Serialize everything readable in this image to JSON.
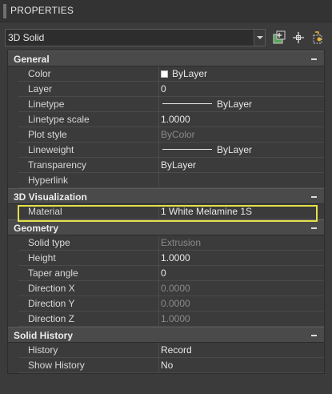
{
  "palette": {
    "title": "PROPERTIES"
  },
  "selector": {
    "value": "3D Solid"
  },
  "toolbar_icons": [
    "toggle-pickadd-icon",
    "select-objects-icon",
    "quick-select-icon"
  ],
  "sections": {
    "general": {
      "title": "General",
      "rows": [
        {
          "label": "Color",
          "value": "ByLayer"
        },
        {
          "label": "Layer",
          "value": "0"
        },
        {
          "label": "Linetype",
          "value": "ByLayer"
        },
        {
          "label": "Linetype scale",
          "value": "1.0000"
        },
        {
          "label": "Plot style",
          "value": "ByColor"
        },
        {
          "label": "Lineweight",
          "value": "ByLayer"
        },
        {
          "label": "Transparency",
          "value": "ByLayer"
        },
        {
          "label": "Hyperlink",
          "value": ""
        }
      ]
    },
    "visualization": {
      "title": "3D Visualization",
      "rows": [
        {
          "label": "Material",
          "value": "1 White Melamine 1S"
        }
      ]
    },
    "geometry": {
      "title": "Geometry",
      "rows": [
        {
          "label": "Solid type",
          "value": "Extrusion"
        },
        {
          "label": "Height",
          "value": "1.0000"
        },
        {
          "label": "Taper angle",
          "value": "0"
        },
        {
          "label": "Direction X",
          "value": "0.0000"
        },
        {
          "label": "Direction Y",
          "value": "0.0000"
        },
        {
          "label": "Direction Z",
          "value": "1.0000"
        }
      ]
    },
    "history": {
      "title": "Solid History",
      "rows": [
        {
          "label": "History",
          "value": "Record"
        },
        {
          "label": "Show History",
          "value": "No"
        }
      ]
    }
  },
  "colors": {
    "highlight": "#e5e04a",
    "swatch": "#ffffff",
    "background": "#3b3b3b",
    "section_header": "#4a4a4a"
  }
}
